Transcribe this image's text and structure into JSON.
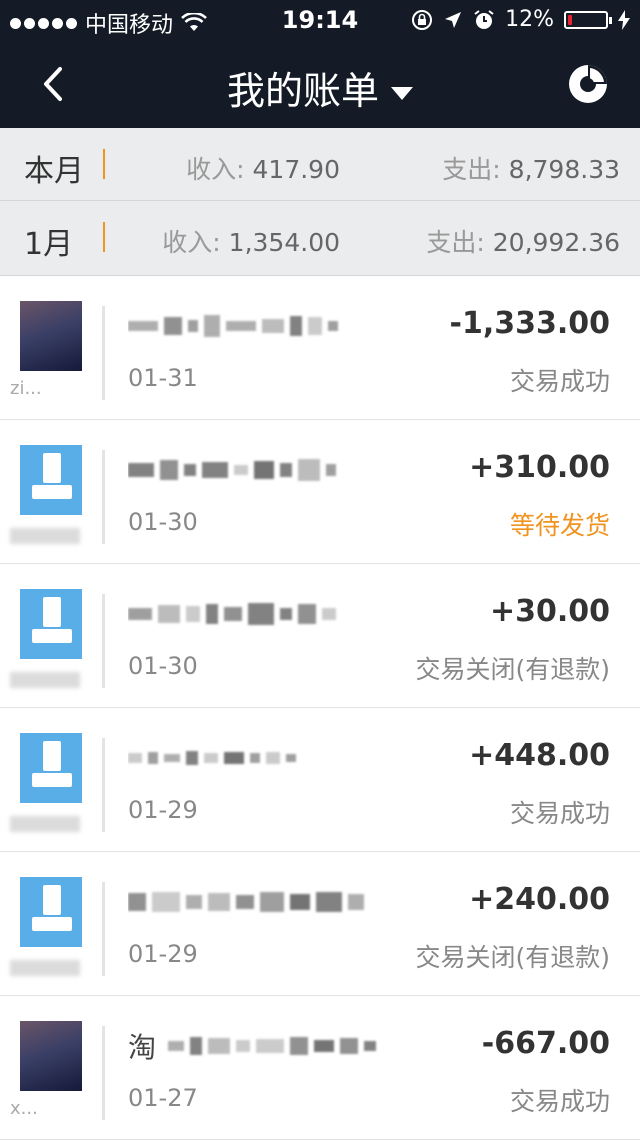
{
  "status_bar": {
    "carrier": "中国移动",
    "time": "19:14",
    "battery_text": "12%",
    "battery_level": 0.12
  },
  "nav": {
    "title": "我的账单"
  },
  "summaries": [
    {
      "label": "本月",
      "income_label": "收入:",
      "income": "417.90",
      "expense_label": "支出:",
      "expense": "8,798.33"
    },
    {
      "label": "1月",
      "income_label": "收入:",
      "income": "1,354.00",
      "expense_label": "支出:",
      "expense": "20,992.36"
    }
  ],
  "transactions": [
    {
      "avatar": "photo",
      "name": "zi...",
      "desc_lead": "",
      "date": "01-31",
      "amount": "-1,333.00",
      "status": "交易成功",
      "status_type": "success"
    },
    {
      "avatar": "default",
      "name": "",
      "desc_lead": "",
      "date": "01-30",
      "amount": "+310.00",
      "status": "等待发货",
      "status_type": "pending"
    },
    {
      "avatar": "default",
      "name": "",
      "desc_lead": "",
      "date": "01-30",
      "amount": "+30.00",
      "status": "交易关闭(有退款)",
      "status_type": "closed"
    },
    {
      "avatar": "default",
      "name": "",
      "desc_lead": "",
      "date": "01-29",
      "amount": "+448.00",
      "status": "交易成功",
      "status_type": "success"
    },
    {
      "avatar": "default",
      "name": "",
      "desc_lead": "",
      "date": "01-29",
      "amount": "+240.00",
      "status": "交易关闭(有退款)",
      "status_type": "closed"
    },
    {
      "avatar": "photo",
      "name": "x...",
      "desc_lead": "淘",
      "date": "01-27",
      "amount": "-667.00",
      "status": "交易成功",
      "status_type": "success"
    }
  ],
  "colors": {
    "nav_bg": "#151b26",
    "summary_bg": "#ebeced",
    "accent_orange": "#f19320",
    "default_avatar": "#5aaee8"
  },
  "icons": {
    "back": "chevron-left-icon",
    "title_dropdown": "caret-down-icon",
    "chart": "pie-chart-icon",
    "wifi": "wifi-icon",
    "lock": "rotation-lock-icon",
    "location": "location-arrow-icon",
    "alarm": "alarm-icon",
    "charging": "bolt-icon"
  }
}
